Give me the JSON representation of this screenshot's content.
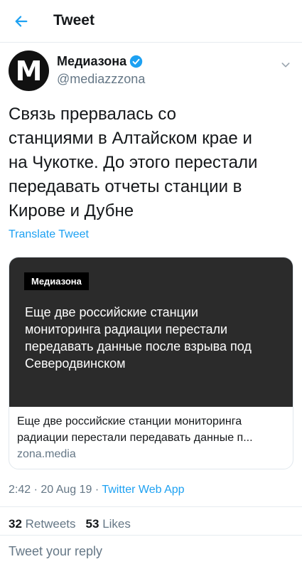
{
  "header": {
    "title": "Tweet",
    "back_icon": "arrow-left-icon",
    "accent": "#1da1f2"
  },
  "tweet": {
    "avatar_letter": "M",
    "display_name": "Медиазона",
    "handle": "@mediazzzona",
    "text": "Связь прервалась со\nстанциями в Алтайском крае и\nна Чукотке. До этого перестали\nпередавать отчеты станции в\nКирове и Дубне",
    "translate": "Translate Tweet",
    "card": {
      "logo": "Медиазона",
      "image_text": "Еще две российские станции\nмониторинга радиации перестали\nпередавать данные после взрыва под\nСеверодвинском",
      "title": "Еще две российские станции мониторинга\nрадиации перестали передавать данные п...",
      "domain": "zona.media"
    },
    "meta": {
      "time": "2:42 · 20 Aug 19 · ",
      "app": "Twitter Web App"
    },
    "stats": {
      "retweets_count": "32",
      "retweets_label": "Retweets",
      "likes_count": "53",
      "likes_label": "Likes"
    }
  },
  "reply": {
    "placeholder": "Tweet your reply"
  }
}
